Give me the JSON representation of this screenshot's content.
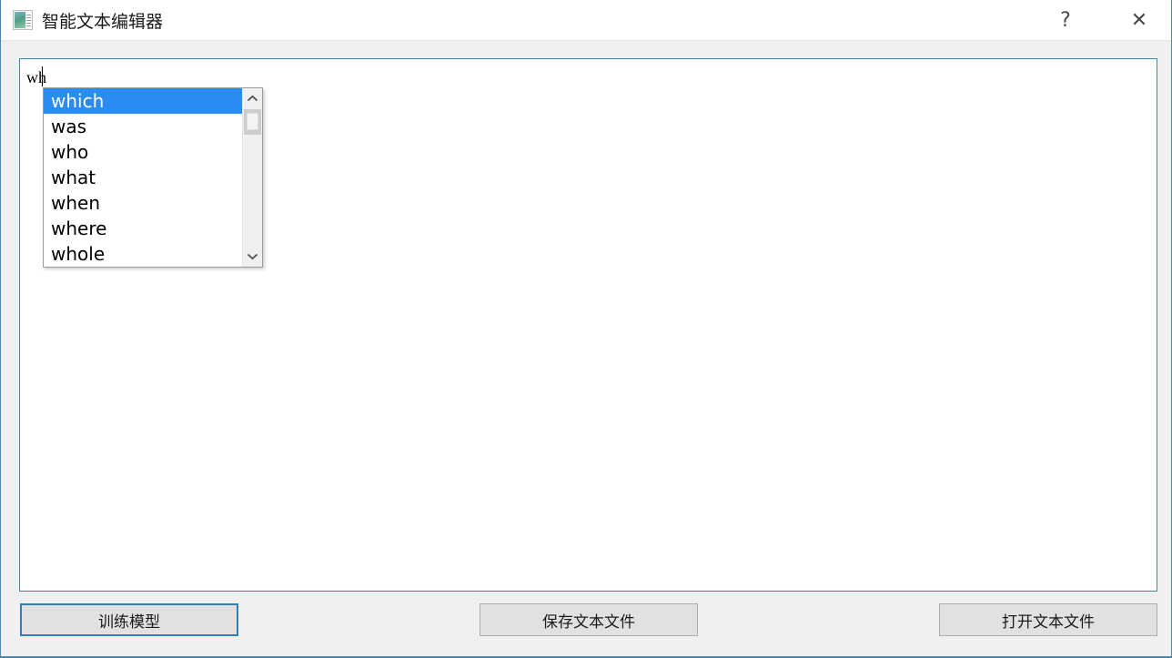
{
  "window": {
    "title": "智能文本编辑器",
    "icon": "text-editor-icon",
    "help_label": "?",
    "close_label": "✕",
    "accent_color": "#3f86ad",
    "background_color": "#f0f0f0"
  },
  "editor": {
    "content": "wh",
    "caret_visible": true
  },
  "autocomplete": {
    "selected_index": 0,
    "highlight_color": "#2a8bf0",
    "scroll_up_icon": "chevron-up-icon",
    "scroll_down_icon": "chevron-down-icon",
    "items": [
      {
        "label": "which"
      },
      {
        "label": "was"
      },
      {
        "label": "who"
      },
      {
        "label": "what"
      },
      {
        "label": "when"
      },
      {
        "label": "where"
      },
      {
        "label": "whole"
      }
    ]
  },
  "buttons": {
    "train": "训练模型",
    "save": "保存文本文件",
    "open": "打开文本文件"
  }
}
